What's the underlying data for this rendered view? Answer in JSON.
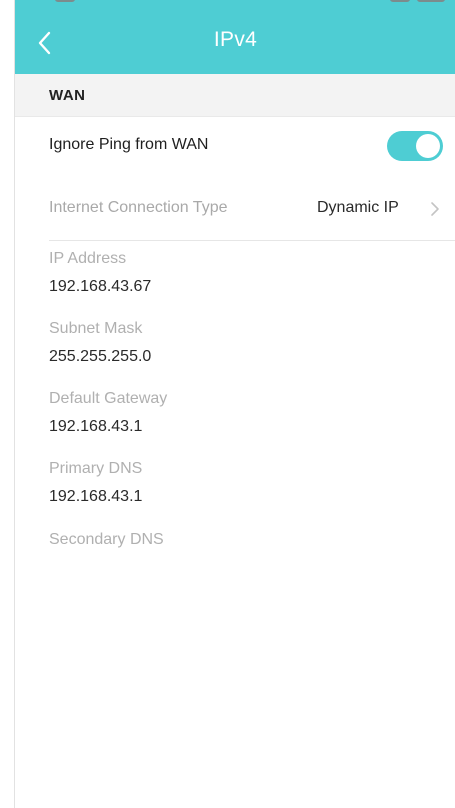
{
  "header": {
    "title": "IPv4",
    "back_icon": "chevron-left-icon",
    "color": "#4ecdd3"
  },
  "section": {
    "title": "WAN"
  },
  "ignore_ping": {
    "label": "Ignore Ping from WAN",
    "enabled": true
  },
  "connection_type": {
    "label": "Internet Connection Type",
    "value": "Dynamic IP",
    "icon": "chevron-right-icon"
  },
  "fields": [
    {
      "label": "IP Address",
      "value": "192.168.43.67"
    },
    {
      "label": "Subnet Mask",
      "value": "255.255.255.0"
    },
    {
      "label": "Default Gateway",
      "value": "192.168.43.1"
    },
    {
      "label": "Primary DNS",
      "value": "192.168.43.1"
    },
    {
      "label": "Secondary DNS",
      "value": ""
    }
  ]
}
